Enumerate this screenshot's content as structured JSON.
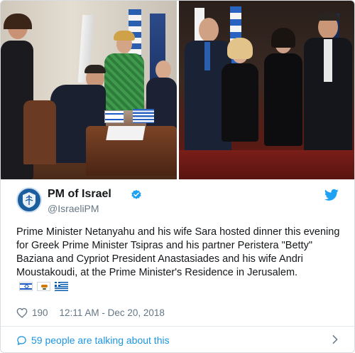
{
  "tweet": {
    "display_name": "PM of Israel",
    "handle": "@IsraeliPM",
    "verified": true,
    "text": "Prime Minister Netanyahu and his wife Sara  hosted dinner this evening for Greek Prime Minister Tsipras and his partner Peristera \"Betty\" Baziana and Cypriot President Anastasiades and his wife Andri Moustakoudi, at the Prime Minister's Residence in Jerusalem.",
    "flag_emojis": [
      "israel-flag-icon",
      "cyprus-flag-icon",
      "greece-flag-icon"
    ],
    "likes": "190",
    "timestamp": "12:11 AM - Dec 20, 2018",
    "conversation_link": "59 people are talking about this"
  },
  "colors": {
    "link_blue": "#1b95e0",
    "twitter_blue": "#1da1f2",
    "muted_gray": "#657786",
    "text_dark": "#14171a"
  },
  "icons": {
    "avatar": "israel-state-emblem-avatar",
    "verified": "verified-badge-icon",
    "brand": "twitter-bird-icon",
    "like": "heart-icon",
    "reply": "speech-bubble-icon",
    "more": "chevron-right-icon"
  }
}
